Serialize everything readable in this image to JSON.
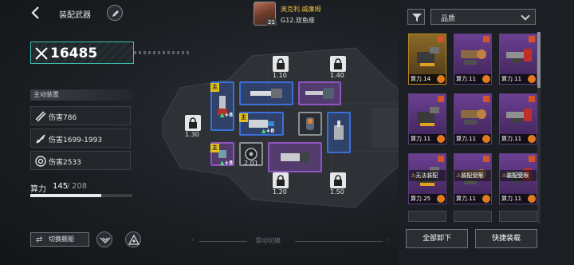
{
  "header": {
    "title": "装配武器"
  },
  "captain": {
    "name": "奥克利.威廉姆",
    "level": "21",
    "rank": "G12.双鱼座"
  },
  "power": {
    "value": "16485"
  },
  "left_panel": {
    "section_label": "主动装置",
    "stats": [
      {
        "icon": "missile-icon",
        "text": "伤害786"
      },
      {
        "icon": "rocket-icon",
        "text": "伤害1699-1993"
      },
      {
        "icon": "gear-target-icon",
        "text": "伤害2533"
      }
    ],
    "capacity": {
      "label": "算力",
      "used": "145",
      "sep": "/",
      "total": "208",
      "fraction": 0.697
    }
  },
  "ship": {
    "main_tag": "主",
    "locks": [
      "1.10",
      "1.40",
      "1.30",
      "1.20",
      "1.50"
    ],
    "slot_values": {
      "plus_a": "+8",
      "plus_b": "+8",
      "plus_c": "+8",
      "grey_slot": "2.01"
    }
  },
  "bottom": {
    "switch_label": "切换舰船",
    "swipe_label": "滑动切换"
  },
  "inventory": {
    "quality_label": "品质",
    "cards": [
      {
        "quality": "gold",
        "footer": "算力.14"
      },
      {
        "quality": "purple",
        "footer": "算力.11"
      },
      {
        "quality": "purple",
        "footer": "算力.11"
      },
      {
        "quality": "purple",
        "footer": "算力.11"
      },
      {
        "quality": "purple",
        "footer": "算力.11"
      },
      {
        "quality": "purple",
        "footer": "算力.11"
      },
      {
        "quality": "purple",
        "footer": "算力.25",
        "warn": "无法装配"
      },
      {
        "quality": "purple",
        "footer": "算力.11",
        "warn": "装配受限"
      },
      {
        "quality": "purple",
        "footer": "算力.11",
        "warn": "装配受限"
      }
    ],
    "unload_all": "全部卸下",
    "quick_equip": "快捷装载"
  },
  "colors": {
    "accent_teal": "#3ec0b0",
    "gold": "#f0c040",
    "purple": "#8d54c2",
    "blue": "#3a6ed8"
  }
}
